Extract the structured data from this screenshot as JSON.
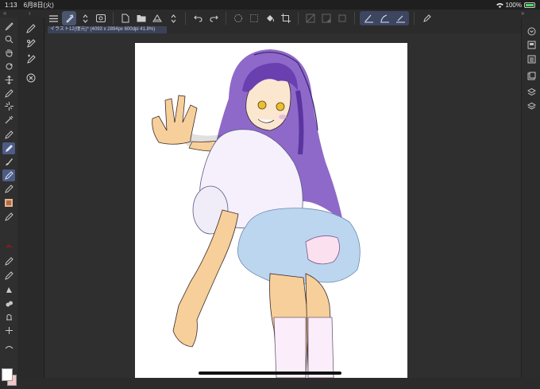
{
  "status": {
    "time": "1:13",
    "date": "6月8日(火)",
    "battery": "100%"
  },
  "collapse": {
    "left": "«",
    "center": "‹",
    "right": "»",
    "right2": "‹"
  },
  "document": {
    "tab_title": "イラスト12(復元)* (4093 x 2894px 600dpi 41.8%)"
  },
  "toolbar": {
    "items": [
      "menu-icon",
      "quick-access-icon",
      "chevron-updown-icon",
      "visibility-icon",
      "new-icon",
      "open-icon",
      "save-icon",
      "chevron-updown-icon",
      "undo-icon",
      "redo-icon",
      "transform-icon",
      "deselect-icon",
      "fill-icon",
      "crop-icon",
      "ruler-icon",
      "gradient-icon",
      "layer-icon",
      "stroke-correction-1-icon",
      "stroke-correction-2-icon",
      "stroke-correction-3-icon",
      "settings-icon"
    ]
  },
  "colors": {
    "accent": "#4d5c85",
    "background": "#2b2b2b",
    "canvas": "#ffffff",
    "main_color": "#ffffff",
    "sub_color": "#f4c6c6"
  }
}
